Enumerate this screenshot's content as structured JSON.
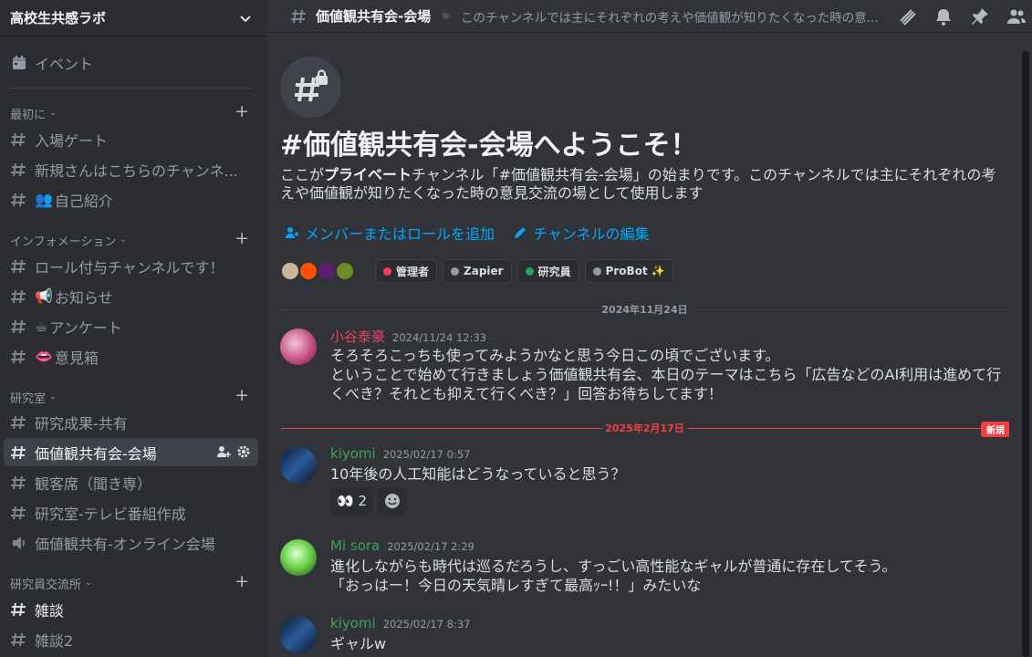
{
  "server": {
    "name": "高校生共感ラボ"
  },
  "sidebar": {
    "event_label": "イベント",
    "categories": [
      {
        "label": "最初に"
      },
      {
        "label": "インフォメーション"
      },
      {
        "label": "研究室"
      },
      {
        "label": "研究員交流所"
      }
    ],
    "channels": [
      {
        "label": "入場ゲート"
      },
      {
        "label": "新規さんはこちらのチャンネ..."
      },
      {
        "emoji": "👥",
        "label": "自己紹介"
      },
      {
        "label": "ロール付与チャンネルです！"
      },
      {
        "emoji": "📢",
        "label": "お知らせ"
      },
      {
        "emoji": "☕",
        "label": "アンケート"
      },
      {
        "emoji": "👄",
        "label": "意見箱"
      },
      {
        "label": "研究成果-共有"
      },
      {
        "label": "価値観共有会-会場"
      },
      {
        "label": "観客席（聞き専）"
      },
      {
        "label": "研究室-テレビ番組作成"
      },
      {
        "label": "価値観共有-オンライン会場"
      },
      {
        "label": "雑談"
      },
      {
        "label": "雑談2"
      }
    ]
  },
  "header": {
    "channel": "価値観共有会-会場",
    "topic": "このチャンネルでは主にそれぞれの考えや価値観が知りたくなった時の意..."
  },
  "welcome": {
    "title": "#価値観共有会-会場へようこそ！",
    "desc_pre": "ここが",
    "desc_bold": "プライベート",
    "desc_post": "チャンネル「#価値観共有会-会場」の始まりです。このチャンネルでは主にそれぞれの考えや価値観が知りたくなった時の意見交流の場として使用します",
    "add_members": "メンバーまたはロールを追加",
    "edit_channel": "チャンネルの編集"
  },
  "roles": [
    {
      "label": "管理者",
      "color": "#f23f5c"
    },
    {
      "label": "Zapier",
      "color": "#949ba4"
    },
    {
      "label": "研究員",
      "color": "#23a55a"
    },
    {
      "label": "ProBot ✨",
      "color": "#949ba4"
    }
  ],
  "dividers": {
    "d1": "2024年11月24日",
    "d2": "2025年2月17日",
    "new_badge": "新規"
  },
  "messages": [
    {
      "author": "小谷泰豪",
      "color": "#e0455f",
      "time": "2024/11/24 12:33",
      "l1": "そろそろこっちも使ってみようかなと思う今日この頃でございます。",
      "l2": "ということで始めて行きましょう価値観共有会、本日のテーマはこちら「広告などのAI利用は進めて行くべき？それとも抑えて行くべき？」回答お待ちしてます！"
    },
    {
      "author": "kiyomi",
      "color": "#3ba55c",
      "time": "2025/02/17 0:57",
      "l1": "10年後の人工知能はどうなっていると思う？",
      "reaction_emoji": "👀",
      "reaction_count": "2"
    },
    {
      "author": "Mi sora",
      "color": "#3ba55c",
      "time": "2025/02/17 2:29",
      "l1": "進化しながらも時代は巡るだろうし、すっごい高性能なギャルが普通に存在してそう。",
      "l2": "「おっはー！今日の天気晴レすぎて最高ｯｰ!！」みたいな"
    },
    {
      "author": "kiyomi",
      "color": "#3ba55c",
      "time": "2025/02/17 8:37",
      "l1": "ギャルw"
    }
  ],
  "colors": {
    "link": "#00a8fc",
    "new": "#f23f43",
    "bg": "#313338",
    "sidebar": "#2b2d31"
  }
}
